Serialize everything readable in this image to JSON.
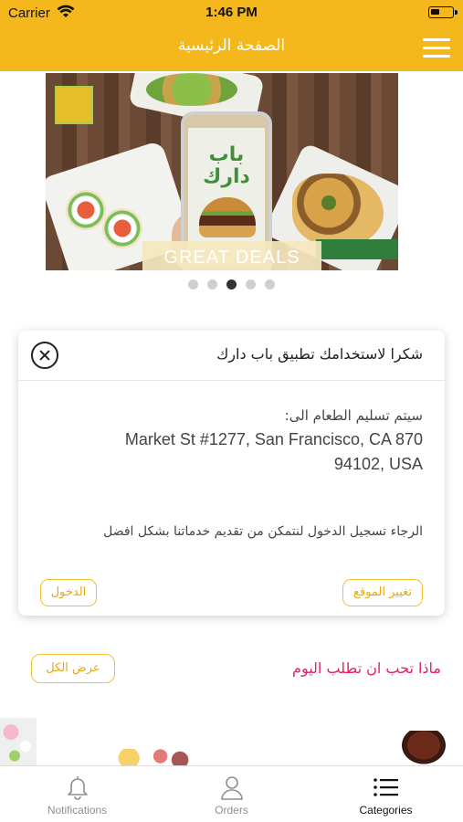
{
  "status_bar": {
    "carrier": "Carrier",
    "time": "1:46 PM"
  },
  "header": {
    "title": "الصفحة الرئيسية",
    "menu_icon": "hamburger-menu-icon",
    "background_color": "#f4b81c"
  },
  "banner": {
    "brand_text": "باب دارك",
    "caption": "GREAT DEALS",
    "carousel_pages": 5,
    "active_page": 3
  },
  "dialog": {
    "title": "شكرا لاستخدامك تطبيق باب دارك",
    "deliver_label": "سيتم تسليم الطعام الى:",
    "address": "Market St #1277, San Francisco, CA 870 94102, USA",
    "login_message": "الرجاء تسجيل الدخول لنتمكن من تقديم خدماتنا بشكل افضل",
    "change_location_label": "تغيير الموقع",
    "login_label": "الدخول"
  },
  "today_section": {
    "title": "ماذا تحب ان تطلب اليوم",
    "view_all_label": "عرض الكل",
    "title_color": "#e41e6c"
  },
  "tabbar": {
    "tabs": [
      {
        "label": "Notifications",
        "icon": "bell-icon",
        "active": false
      },
      {
        "label": "Orders",
        "icon": "person-icon",
        "active": false
      },
      {
        "label": "Categories",
        "icon": "list-icon",
        "active": true
      }
    ]
  },
  "accent_color": "#f1c02e"
}
